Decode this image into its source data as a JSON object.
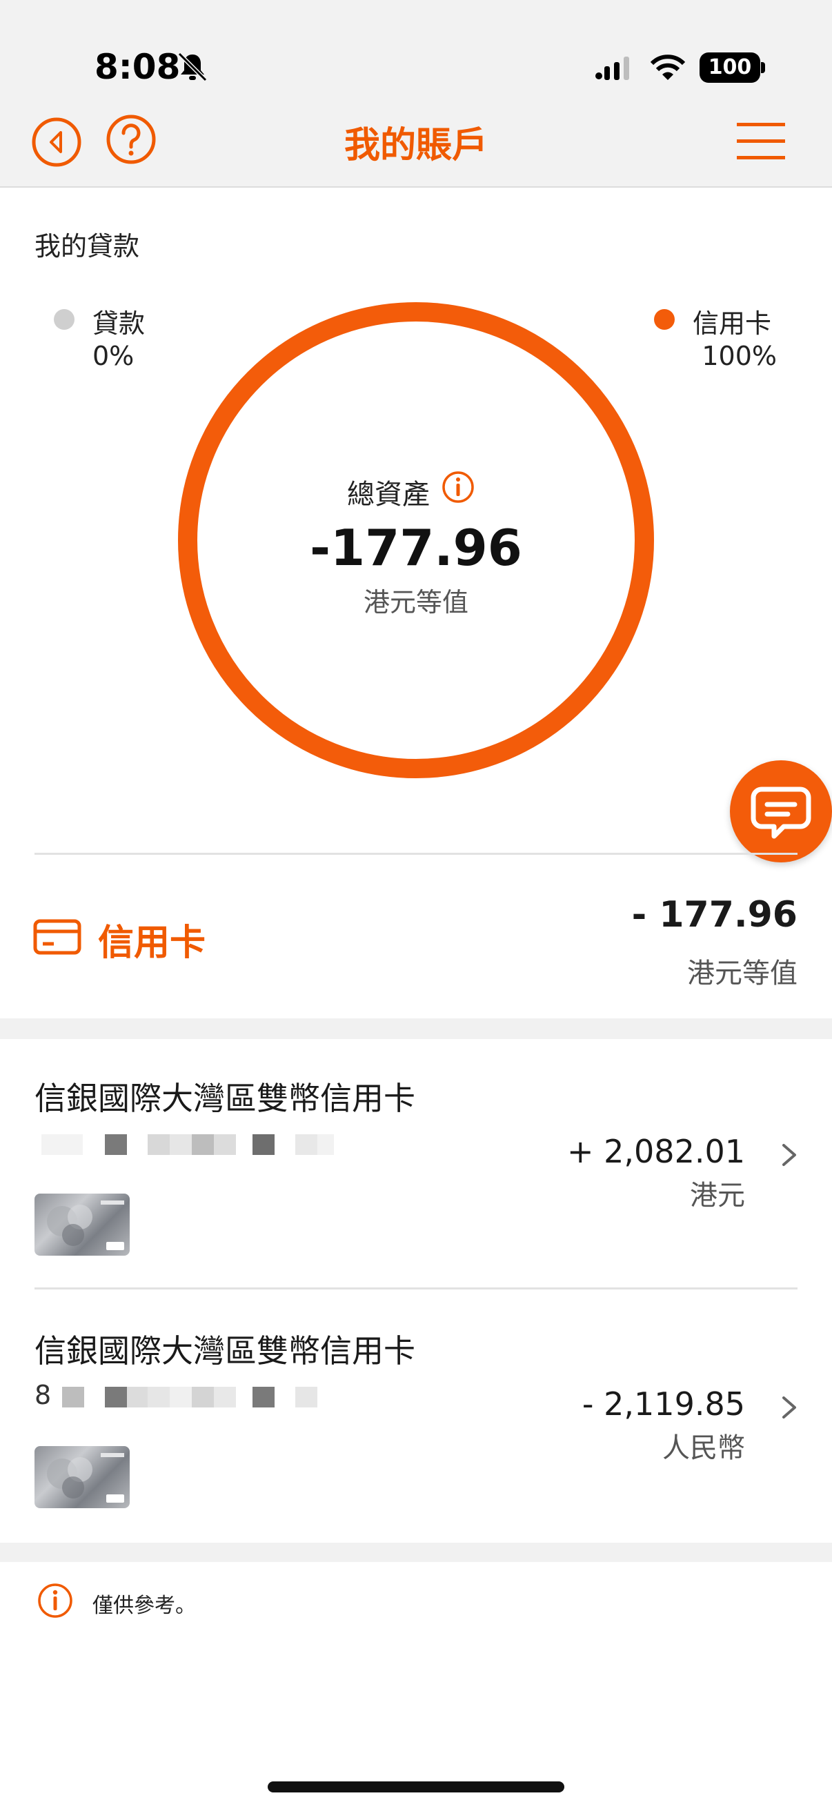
{
  "status_bar": {
    "time": "8:08",
    "battery": "100"
  },
  "nav": {
    "title": "我的賬戶",
    "icons": [
      "back-icon",
      "help-icon",
      "menu-icon"
    ]
  },
  "summary": {
    "title": "我的貸款",
    "legend": [
      {
        "label": "貸款",
        "percent": "0%",
        "color": "#cfcfcf"
      },
      {
        "label": "信用卡",
        "percent": "100%",
        "color": "#f35c0a"
      }
    ],
    "donut_shares": {
      "loan": 0,
      "credit_card": 1
    },
    "total_label": "總資產",
    "total_value": "-177.96",
    "total_unit": "港元等值"
  },
  "category": {
    "label": "信用卡",
    "amount": "- 177.96",
    "unit": "港元等值"
  },
  "cards": [
    {
      "name": "信銀國際大灣區雙幣信用卡",
      "number_prefix": "",
      "amount": "+ 2,082.01",
      "currency": "港元"
    },
    {
      "name": "信銀國際大灣區雙幣信用卡",
      "number_prefix": "8",
      "amount": "- 2,119.85",
      "currency": "人民幣"
    }
  ],
  "footer": {
    "note": "僅供參考。"
  },
  "colors": {
    "accent": "#f05a00",
    "ring": "#f35c0a",
    "background_grey": "#f2f2f2"
  }
}
